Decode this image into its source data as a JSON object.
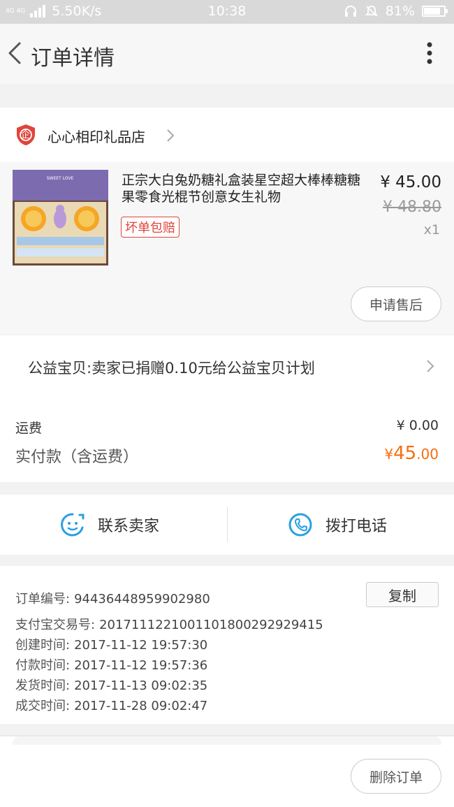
{
  "status_bar": {
    "network_type": "4G 4G",
    "speed": "5.50K/s",
    "time": "10:38",
    "battery": "81%",
    "battery_level": 0.81
  },
  "header": {
    "title": "订单详情"
  },
  "shop": {
    "name": "心心相印礼品店",
    "logo_char": "企"
  },
  "product": {
    "title": "正宗大白兔奶糖礼盒装星空超大棒棒糖糖果零食光棍节创意女生礼物",
    "badge": "坏单包赔",
    "price": "¥ 45.00",
    "original_price": "¥ 48.80",
    "quantity": "x1",
    "after_sale_label": "申请售后",
    "thumb_caption": "SWEET LOVE"
  },
  "charity": {
    "text": "公益宝贝:卖家已捐赠0.10元给公益宝贝计划"
  },
  "totals": {
    "shipping_label": "运费",
    "shipping_value": "¥ 0.00",
    "paid_label": "实付款（含运费）",
    "paid_currency": "¥",
    "paid_int": "45",
    "paid_dec": ".00"
  },
  "contact": {
    "seller_label": "联系卖家",
    "phone_label": "拨打电话"
  },
  "order_info": {
    "order_no_label": "订单编号:",
    "order_no": "94436448959902980",
    "copy_label": "复制",
    "alipay_label": "支付宝交易号:",
    "alipay_no": "2017111221001101800292929415",
    "created_label": "创建时间:",
    "created": "2017-11-12 19:57:30",
    "paid_time_label": "付款时间:",
    "paid_time": "2017-11-12 19:57:36",
    "shipped_label": "发货时间:",
    "shipped": "2017-11-13 09:02:35",
    "done_label": "成交时间:",
    "done": "2017-11-28 09:02:47"
  },
  "footer": {
    "delete_label": "删除订单"
  },
  "colors": {
    "accent_orange": "#f56e0f",
    "badge_red": "#e0443b",
    "icon_blue": "#2a9fe0"
  }
}
